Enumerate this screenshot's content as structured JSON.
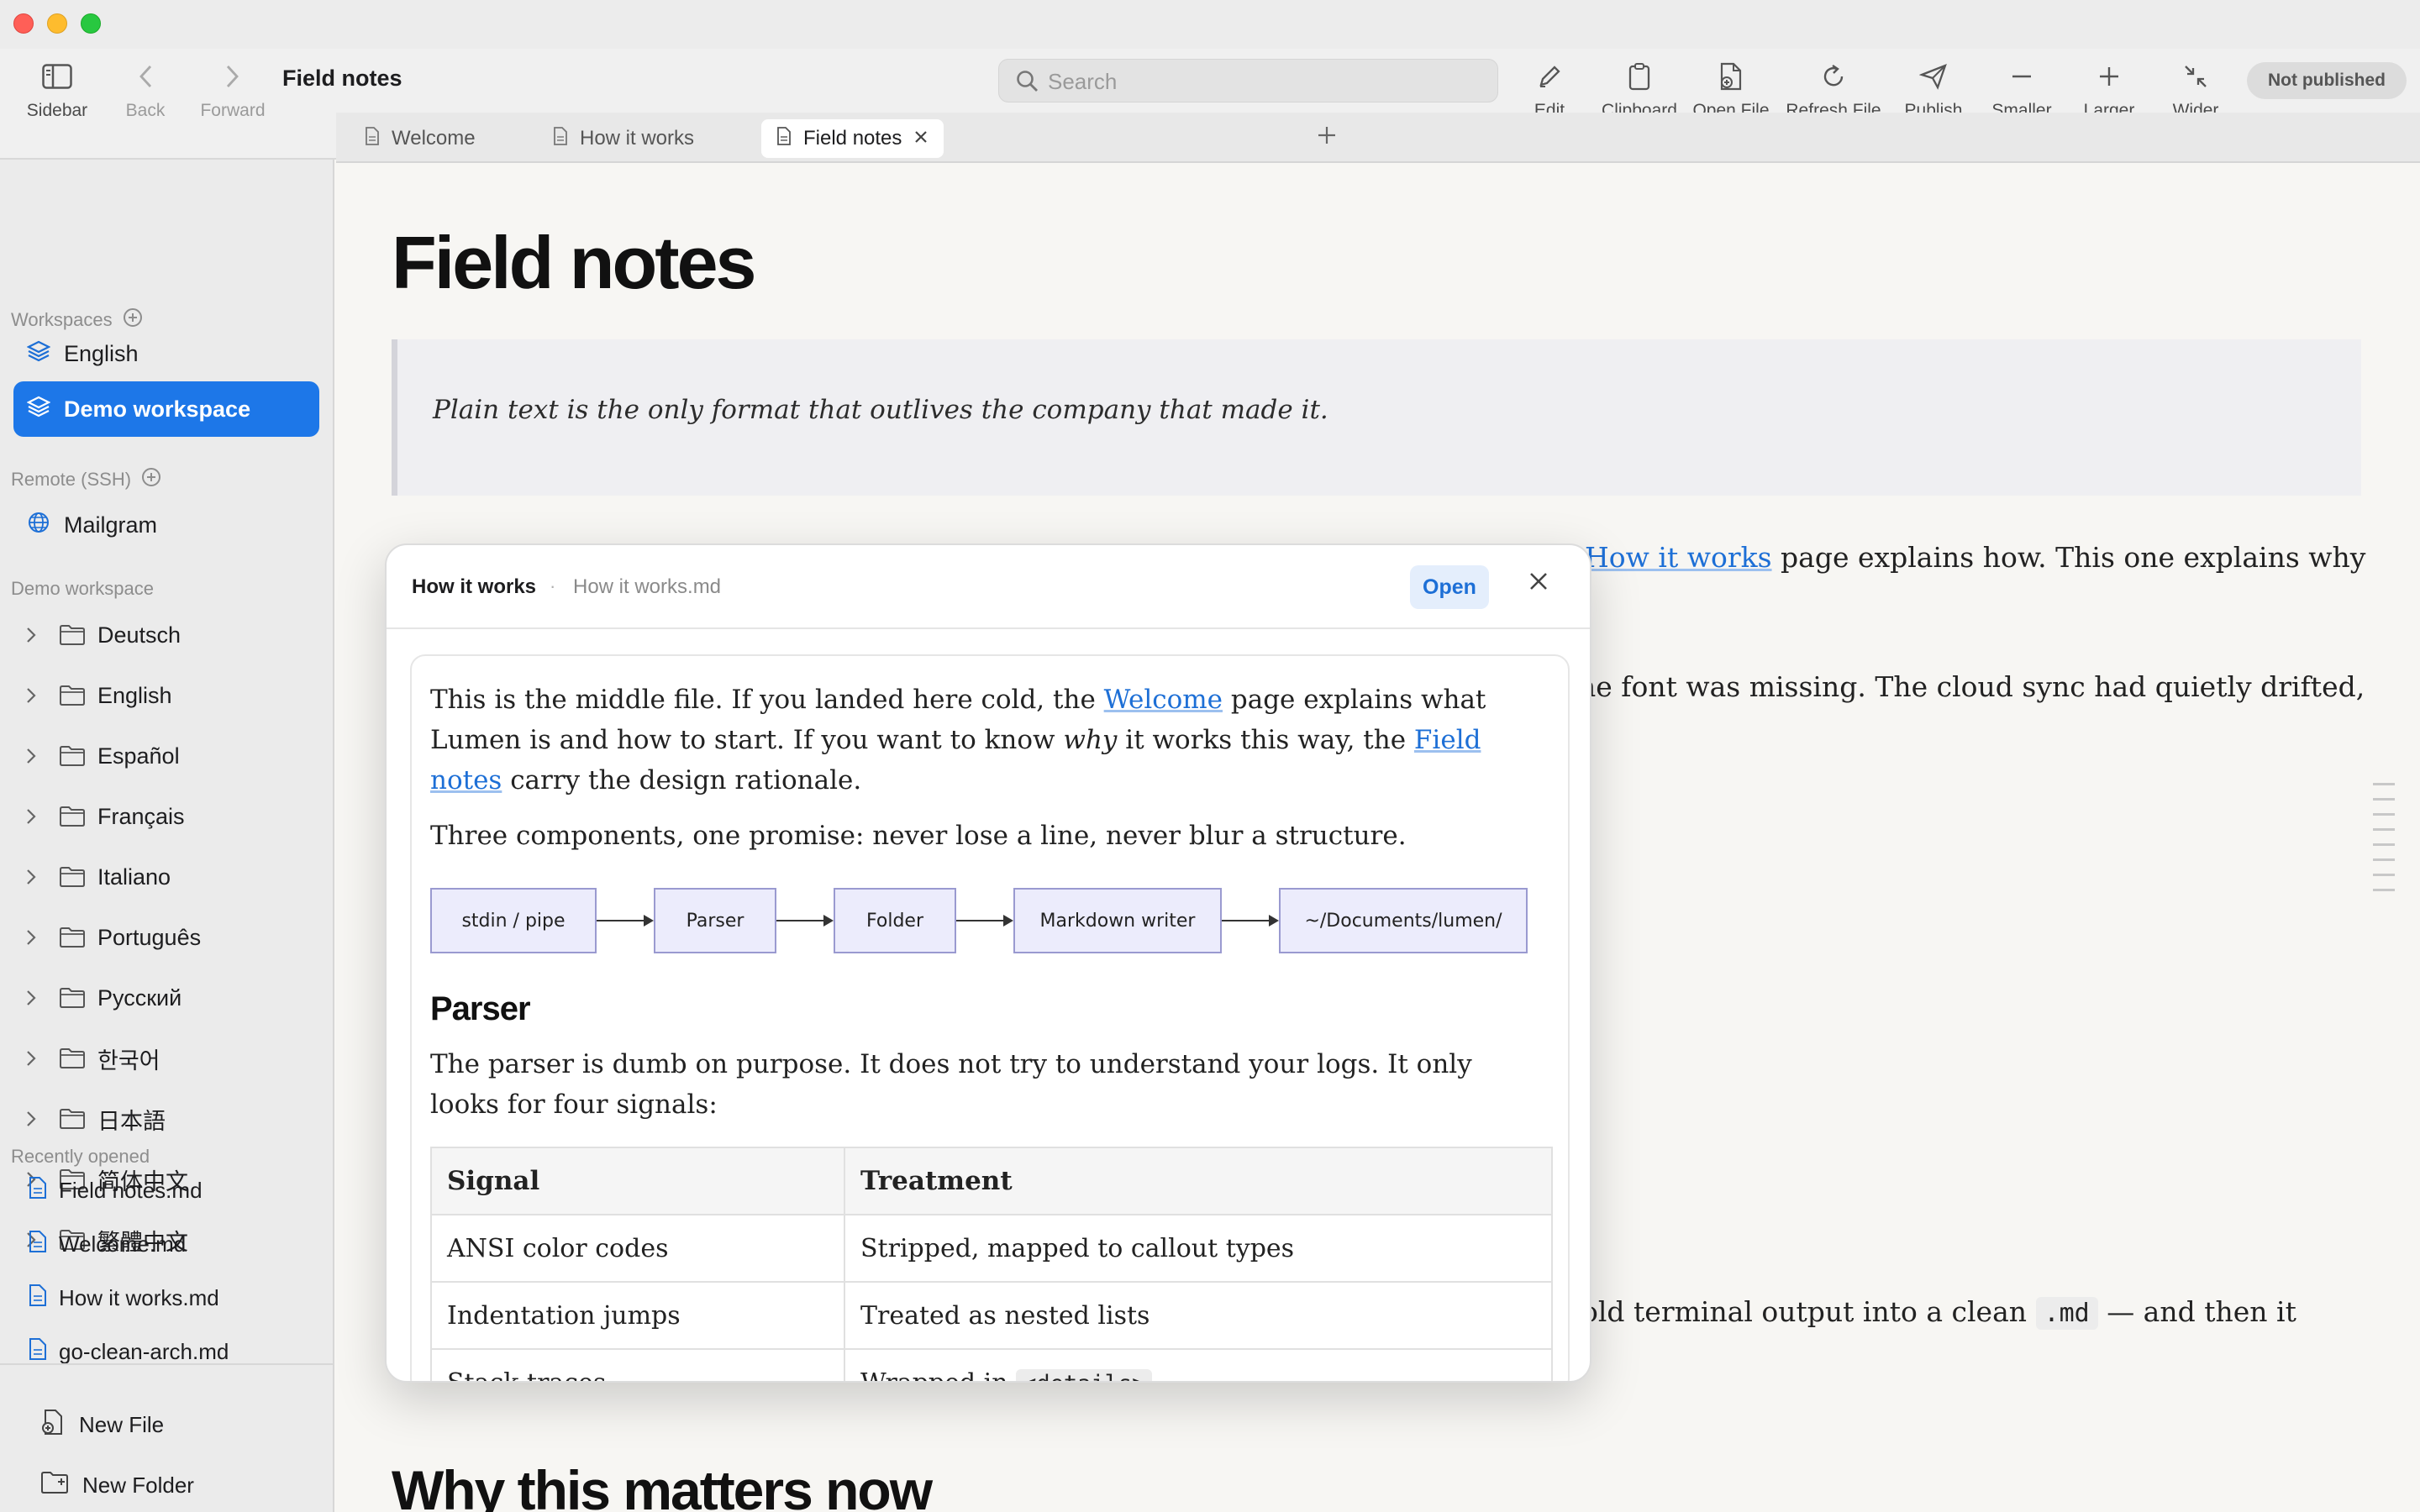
{
  "window": {
    "title": "Field notes"
  },
  "toolbar": {
    "sidebar_label": "Sidebar",
    "back_label": "Back",
    "forward_label": "Forward",
    "search_placeholder": "Search",
    "edit_label": "Edit",
    "clipboard_label": "Clipboard",
    "open_file_label": "Open File",
    "refresh_label": "Refresh File",
    "publish_label": "Publish",
    "smaller_label": "Smaller",
    "larger_label": "Larger",
    "wider_label": "Wider",
    "status_badge": "Not published"
  },
  "sidebar": {
    "workspaces_header": "Workspaces",
    "workspaces": [
      "English",
      "Demo workspace"
    ],
    "active_workspace": "Demo workspace",
    "remote_header": "Remote (SSH)",
    "remote": [
      "Mailgram"
    ],
    "tree_header": "Demo workspace",
    "folders": [
      "Deutsch",
      "English",
      "Español",
      "Français",
      "Italiano",
      "Português",
      "Русский",
      "한국어",
      "日本語",
      "简体中文",
      "繁體中文"
    ],
    "recent_header": "Recently opened",
    "recent": [
      "Field notes.md",
      "Welcome.md",
      "How it works.md",
      "go-clean-arch.md"
    ],
    "new_file_label": "New File",
    "new_folder_label": "New Folder"
  },
  "tabs": [
    {
      "label": "Welcome"
    },
    {
      "label": "How it works"
    },
    {
      "label": "Field notes",
      "active": true
    }
  ],
  "document": {
    "title": "Field notes",
    "quote": "Plain text is the only format that outlives the company that made it.",
    "p1_pre": "e ",
    "p1_link": "How it works",
    "p1_post": " page explains how. This one explains why",
    "p2": "he font was missing. The cloud sync had quietly drifted,",
    "p3_pre": "old terminal output into a clean ",
    "p3_code": ".md",
    "p3_post": " — and then it",
    "h2": "Why this matters now"
  },
  "popover": {
    "title": "How it works",
    "separator": "·",
    "filename": "How it works.md",
    "open_label": "Open",
    "p1_a": "This is the middle file. If you landed here cold, the ",
    "p1_link1": "Welcome",
    "p1_b": " page explains what Lumen is and how to start. If you want to know ",
    "p1_em": "why",
    "p1_c": " it works this way, the ",
    "p1_link2": "Field notes",
    "p1_d": " carry the design rationale.",
    "p2": "Three components, one promise: never lose a line, never blur a structure.",
    "flow": [
      "stdin / pipe",
      "Parser",
      "Folder",
      "Markdown writer",
      "~/Documents/lumen/"
    ],
    "h2": "Parser",
    "p3": "The parser is dumb on purpose. It does not try to understand your logs. It only looks for four signals:",
    "table": {
      "headers": [
        "Signal",
        "Treatment"
      ],
      "rows": [
        [
          "ANSI color codes",
          "Stripped, mapped to callout types"
        ],
        [
          "Indentation jumps",
          "Treated as nested lists"
        ],
        [
          "Stack traces",
          "Wrapped in",
          "<details>"
        ]
      ]
    }
  }
}
